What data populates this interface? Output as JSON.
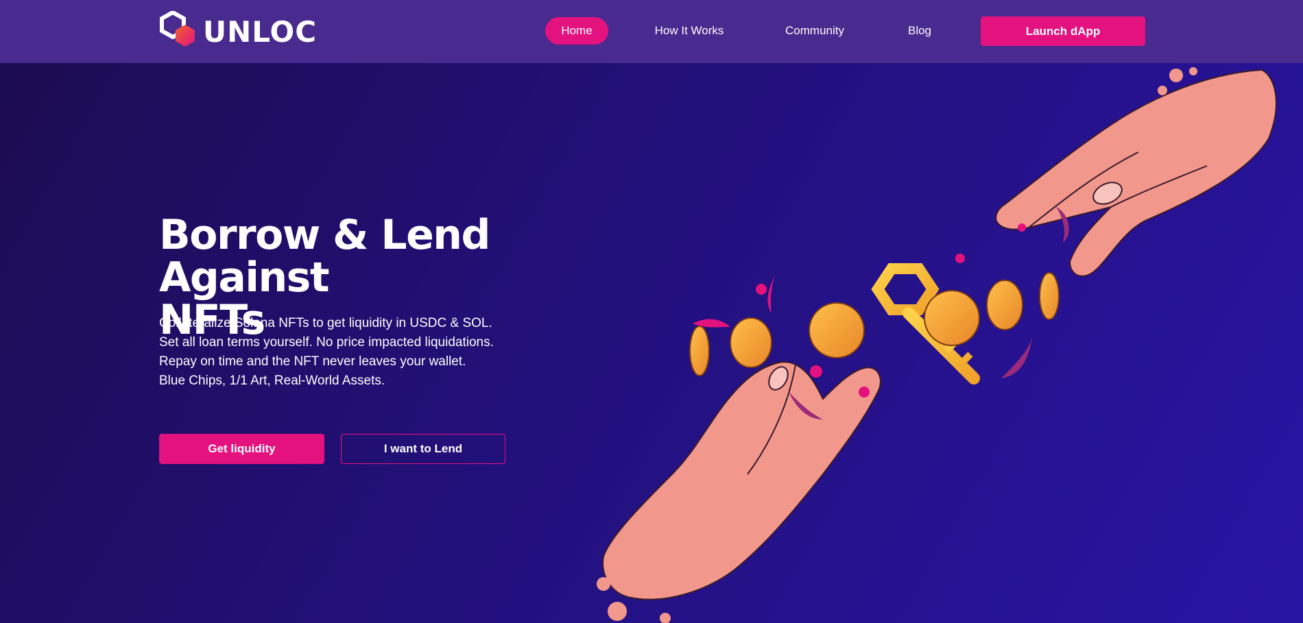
{
  "brand": {
    "name": "UNLOC",
    "colors": {
      "accent": "#e4127f",
      "header": "#492a8e",
      "bg_dark": "#1c0c4f",
      "bg_light": "#2a14a4"
    }
  },
  "nav": {
    "items": [
      {
        "label": "Home",
        "active": true
      },
      {
        "label": "How It Works",
        "active": false
      },
      {
        "label": "Community",
        "active": false
      },
      {
        "label": "Blog",
        "active": false
      }
    ],
    "cta_label": "Launch dApp"
  },
  "hero": {
    "title_line1": "Borrow & Lend Against",
    "title_line2": "NFTs",
    "lines": [
      "Collateralize Solana NFTs to get liquidity in USDC & SOL.",
      "Set all loan terms yourself. No price impacted liquidations.",
      "Repay on time and the NFT never leaves your wallet.",
      "Blue Chips, 1/1 Art, Real-World Assets."
    ],
    "primary_button": "Get liquidity",
    "secondary_button": "I want to Lend"
  },
  "illustration": {
    "icons": [
      "hands-exchange-illustration",
      "key-icon",
      "coin-icon"
    ]
  }
}
